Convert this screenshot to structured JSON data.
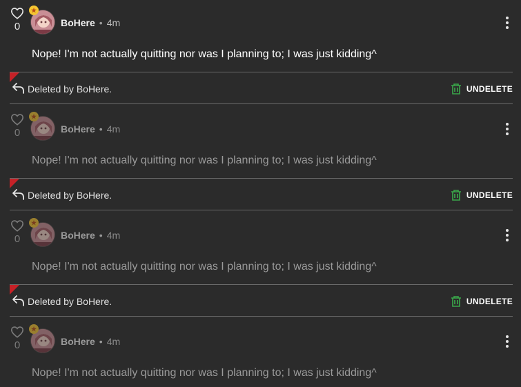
{
  "comments": [
    {
      "username": "BoHere",
      "separator": "•",
      "time": "4m",
      "likes": "0",
      "text": "Nope! I'm not actually quitting nor was I planning to; I was just kidding^"
    },
    {
      "username": "BoHere",
      "separator": "•",
      "time": "4m",
      "likes": "0",
      "text": "Nope! I'm not actually quitting nor was I planning to; I was just kidding^"
    },
    {
      "username": "BoHere",
      "separator": "•",
      "time": "4m",
      "likes": "0",
      "text": "Nope! I'm not actually quitting nor was I planning to; I was just kidding^"
    },
    {
      "username": "BoHere",
      "separator": "•",
      "time": "4m",
      "likes": "0",
      "text": "Nope! I'm not actually quitting nor was I planning to; I was just kidding^"
    }
  ],
  "deleted_bars": [
    {
      "text": "Deleted by BoHere.",
      "action_label": "UNDELETE"
    },
    {
      "text": "Deleted by BoHere.",
      "action_label": "UNDELETE"
    },
    {
      "text": "Deleted by BoHere.",
      "action_label": "UNDELETE"
    }
  ],
  "icons": {
    "like": "heart-icon",
    "reply": "reply-arrow-icon",
    "undelete": "trash-restore-icon",
    "menu": "kebab-menu-icon",
    "badge": "star-badge-icon"
  },
  "colors": {
    "background": "#2b2b2b",
    "corner_flag": "#c52127",
    "undelete_icon": "#3aa84a",
    "badge": "#f5c531"
  }
}
